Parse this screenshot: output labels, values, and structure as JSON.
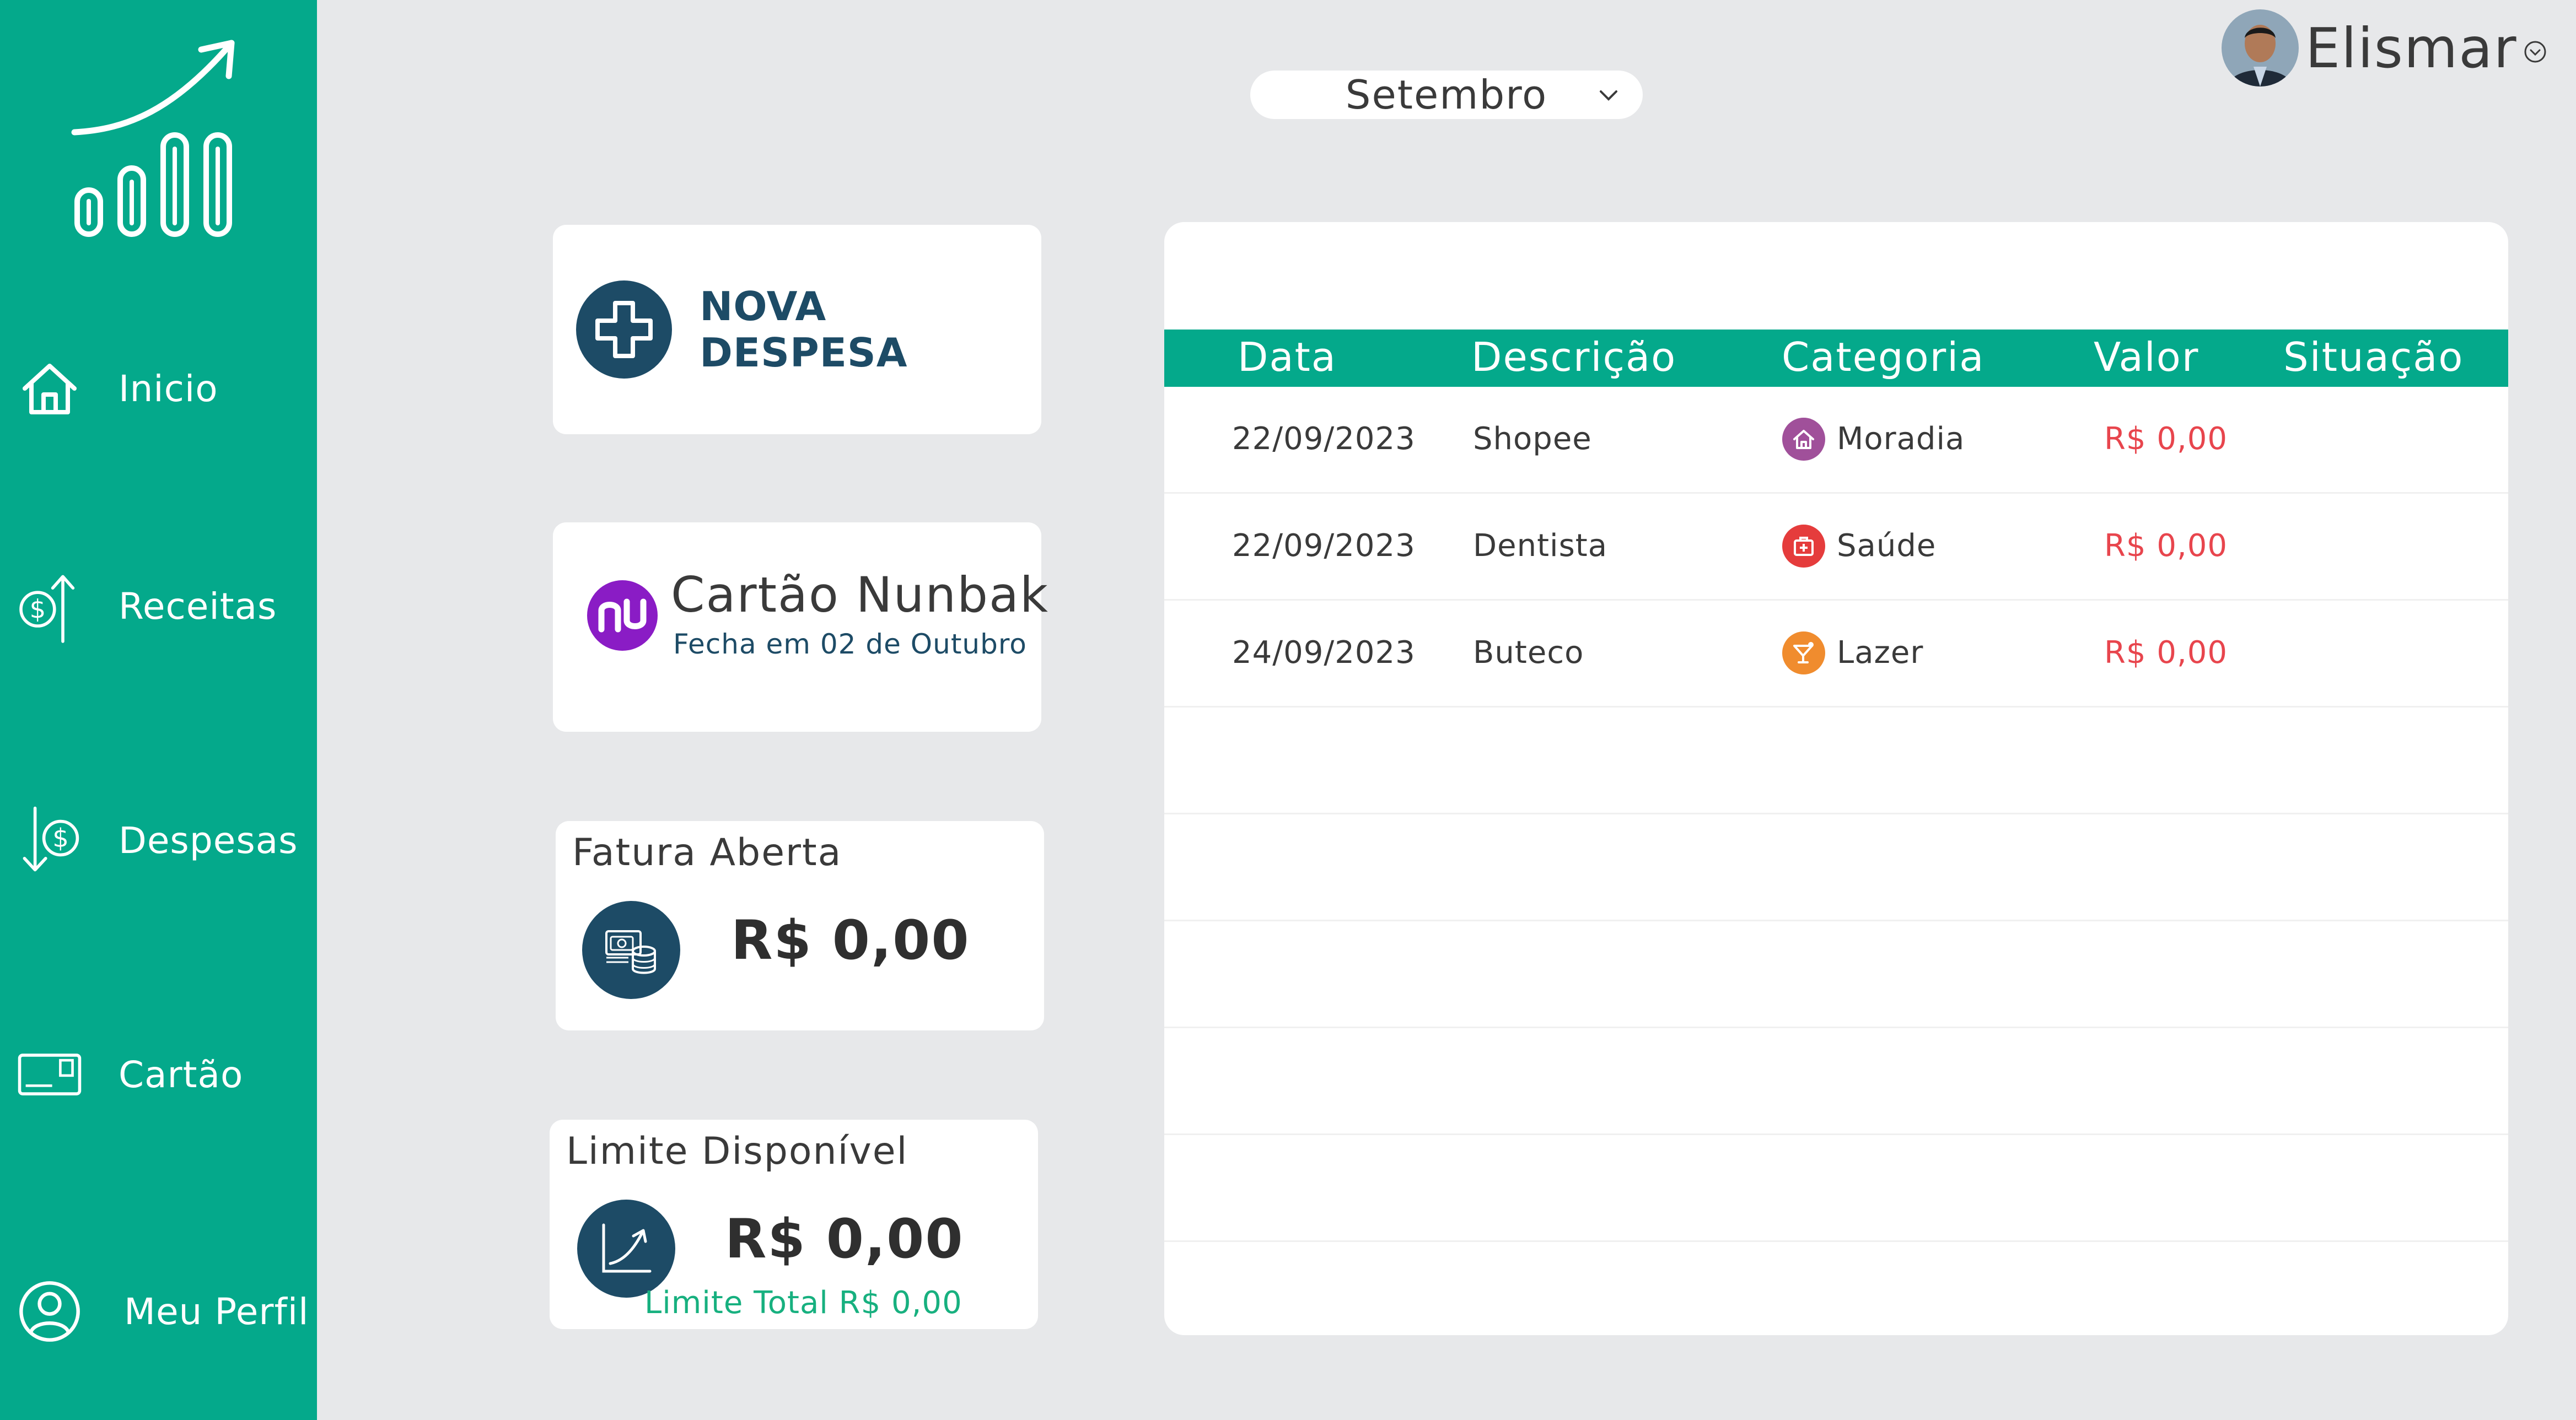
{
  "sidebar": {
    "items": [
      {
        "label": "Inicio",
        "icon": "home-icon"
      },
      {
        "label": "Receitas",
        "icon": "income-icon"
      },
      {
        "label": "Despesas",
        "icon": "expense-icon"
      },
      {
        "label": "Cartão",
        "icon": "card-icon"
      },
      {
        "label": "Meu Perfil",
        "icon": "profile-icon"
      }
    ]
  },
  "header": {
    "month": "Setembro",
    "user_name": "Elismar"
  },
  "cards": {
    "nova_despesa": "NOVA DESPESA",
    "cartao_title": "Cartão Nunbak",
    "cartao_sub": "Fecha em 02 de Outubro",
    "fatura_title": "Fatura Aberta",
    "fatura_value": "R$ 0,00",
    "limite_title": "Limite Disponível",
    "limite_value": "R$ 0,00",
    "limite_total": "Limite Total R$ 0,00"
  },
  "table": {
    "columns": [
      "Data",
      "Descrição",
      "Categoria",
      "Valor",
      "Situação"
    ],
    "rows": [
      {
        "data": "22/09/2023",
        "descricao": "Shopee",
        "categoria": "Moradia",
        "valor": "R$ 0,00",
        "situacao": "",
        "icon": "house-icon",
        "color": "#a0509a"
      },
      {
        "data": "22/09/2023",
        "descricao": "Dentista",
        "categoria": "Saúde",
        "valor": "R$ 0,00",
        "situacao": "",
        "icon": "medkit-icon",
        "color": "#e53c3c"
      },
      {
        "data": "24/09/2023",
        "descricao": "Buteco",
        "categoria": "Lazer",
        "valor": "R$ 0,00",
        "situacao": "",
        "icon": "cocktail-icon",
        "color": "#f08c2e"
      }
    ]
  },
  "colors": {
    "brand_green": "#04a98b",
    "navy": "#1d4b66",
    "nubank_purple": "#8a1cc5",
    "value_red": "#e8454d",
    "limit_green": "#17b07f"
  }
}
